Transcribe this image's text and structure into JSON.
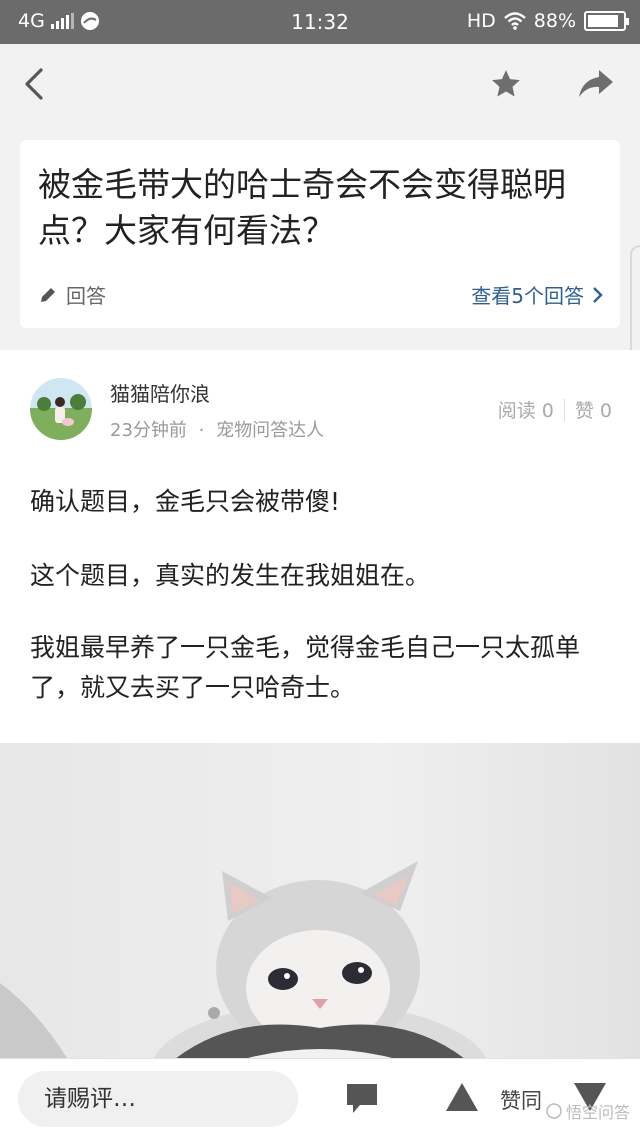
{
  "status_bar": {
    "network": "4G",
    "time": "11:32",
    "hd": "HD",
    "battery": "88%",
    "battery_level": 0.88
  },
  "nav": {
    "icons": [
      "back-arrow-icon",
      "star-icon",
      "share-icon"
    ]
  },
  "question": {
    "title": "被金毛带大的哈士奇会不会变得聪明点？大家有何看法？",
    "answer_label": "回答",
    "view_answers": "查看5个回答"
  },
  "answer": {
    "author": "猫猫陪你浪",
    "time_ago": "23分钟前",
    "separator": "·",
    "badge": "宠物问答达人",
    "reads_label": "阅读",
    "reads": "0",
    "likes_label": "赞",
    "likes": "0",
    "paragraphs": [
      "确认题目，金毛只会被带傻!",
      "这个题目，真实的发生在我姐姐在。",
      "我姐最早养了一只金毛，觉得金毛自己一只太孤单了，就又去买了一只哈奇士。"
    ]
  },
  "bottom_bar": {
    "comment_placeholder": "请赐评…",
    "agree_label": "赞同",
    "watermark": "悟空问答"
  },
  "colors": {
    "status_bar": "#6b6b6b",
    "link": "#2f5f8f",
    "page_bg": "#f2f2f2"
  }
}
